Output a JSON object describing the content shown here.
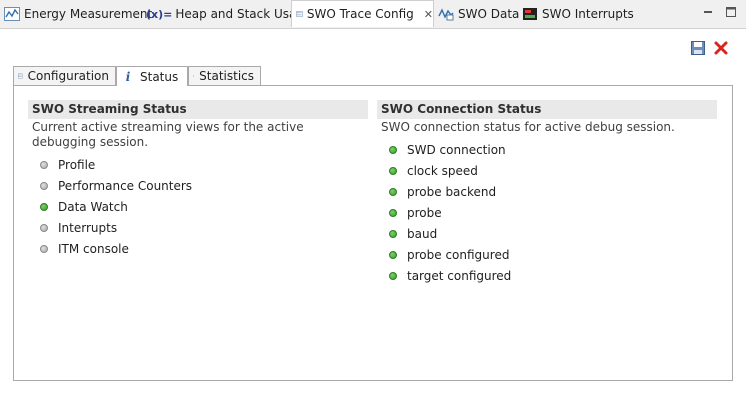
{
  "view_tabs": [
    {
      "label": "Energy Measurement",
      "icon": "energy-wave-icon"
    },
    {
      "label": "Heap and Stack Usage",
      "icon": "heap-stack-icon",
      "prefix": "(x)="
    },
    {
      "label": "SWO Trace Config",
      "icon": "config-list-icon",
      "active": true
    },
    {
      "label": "SWO Data",
      "icon": "swo-data-icon"
    },
    {
      "label": "SWO Interrupts",
      "icon": "interrupts-icon"
    }
  ],
  "inner_tabs": [
    {
      "label": "Configuration",
      "icon": "config-list-icon"
    },
    {
      "label": "Status",
      "icon": "info-icon",
      "active": true
    },
    {
      "label": "Statistics",
      "icon": "statistics-icon"
    }
  ],
  "streaming": {
    "title": "SWO Streaming Status",
    "description": "Current active streaming views for the active debugging session.",
    "items": [
      {
        "label": "Profile",
        "status": "inactive"
      },
      {
        "label": "Performance Counters",
        "status": "inactive"
      },
      {
        "label": "Data Watch",
        "status": "active"
      },
      {
        "label": "Interrupts",
        "status": "inactive"
      },
      {
        "label": "ITM console",
        "status": "inactive"
      }
    ]
  },
  "connection": {
    "title": "SWO Connection Status",
    "description": "SWO connection status for active debug session.",
    "items": [
      {
        "label": "SWD connection",
        "status": "active"
      },
      {
        "label": "clock speed",
        "status": "active"
      },
      {
        "label": "probe backend",
        "status": "active"
      },
      {
        "label": "probe",
        "status": "active"
      },
      {
        "label": "baud",
        "status": "active"
      },
      {
        "label": "probe configured",
        "status": "active"
      },
      {
        "label": "target configured",
        "status": "active"
      }
    ]
  },
  "colors": {
    "active": "#3a9a2a",
    "inactive": "#a8a8a8",
    "section_bg": "#e9e9e9"
  }
}
